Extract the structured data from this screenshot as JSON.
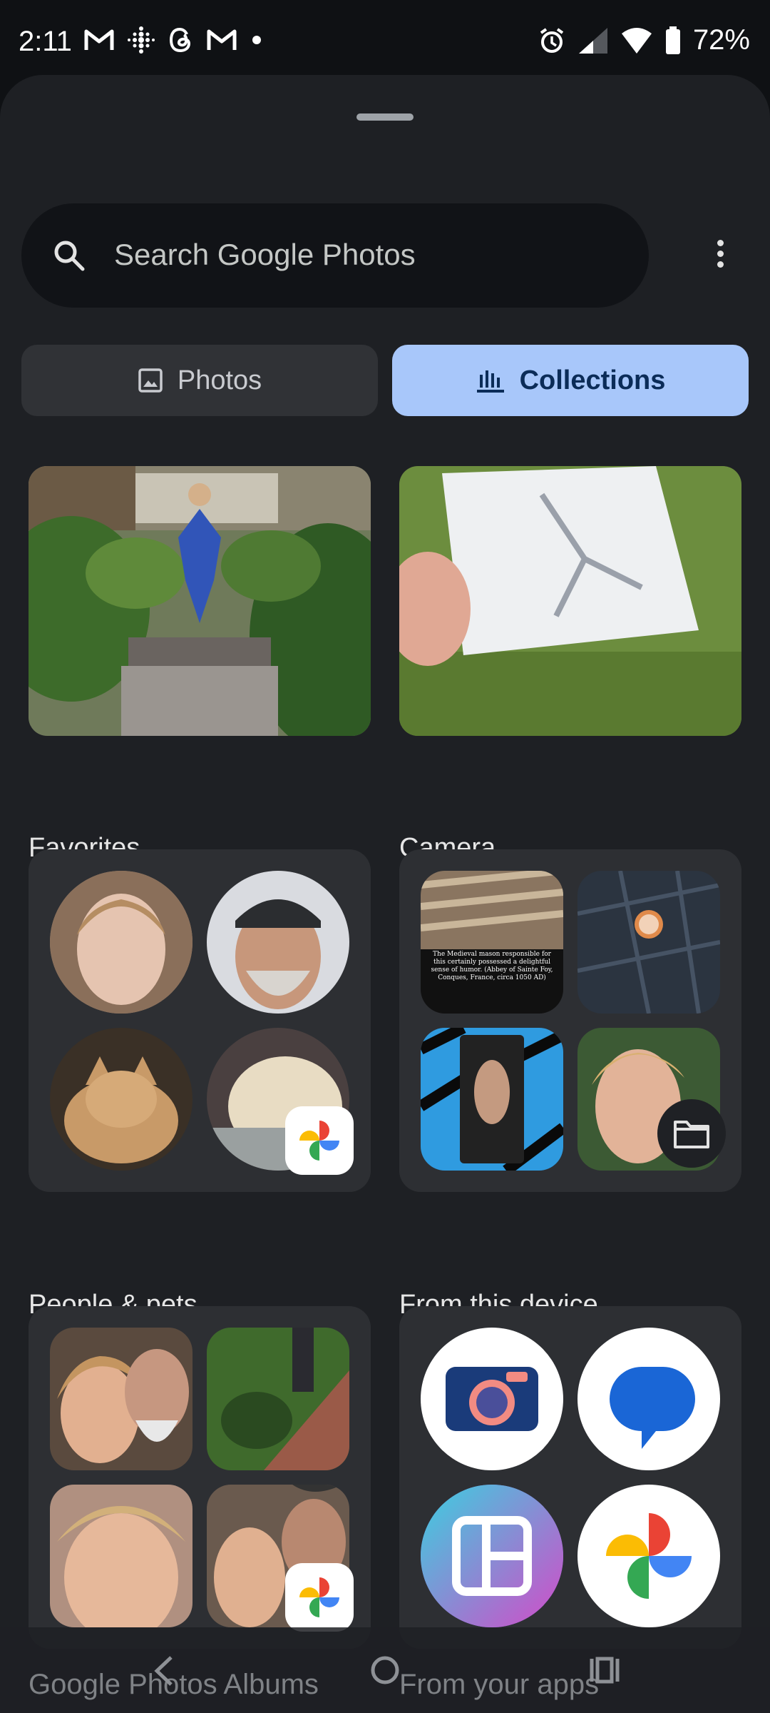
{
  "status_bar": {
    "time": "2:11",
    "battery": "72%",
    "notification_icons": [
      "gmail-icon",
      "fitbit-icon",
      "threads-icon",
      "gmail-icon",
      "dot-icon"
    ]
  },
  "search": {
    "placeholder": "Search Google Photos"
  },
  "tabs": [
    {
      "label": "Photos",
      "selected": false
    },
    {
      "label": "Collections",
      "selected": true
    }
  ],
  "collections": [
    {
      "label": "Favorites"
    },
    {
      "label": "Camera"
    },
    {
      "label": "People & pets"
    },
    {
      "label": "From this device"
    },
    {
      "label": "Google Photos Albums"
    },
    {
      "label": "From your apps"
    }
  ],
  "device_thumb_caption": "The Medieval mason responsible for this certainly possessed a delightful sense of humor. (Abbey of Sainte Foy, Conques, France, circa 1050 AD)",
  "colors": {
    "background": "#1e2024",
    "accent": "#a8c7fa",
    "accent_text": "#0b2c58"
  }
}
